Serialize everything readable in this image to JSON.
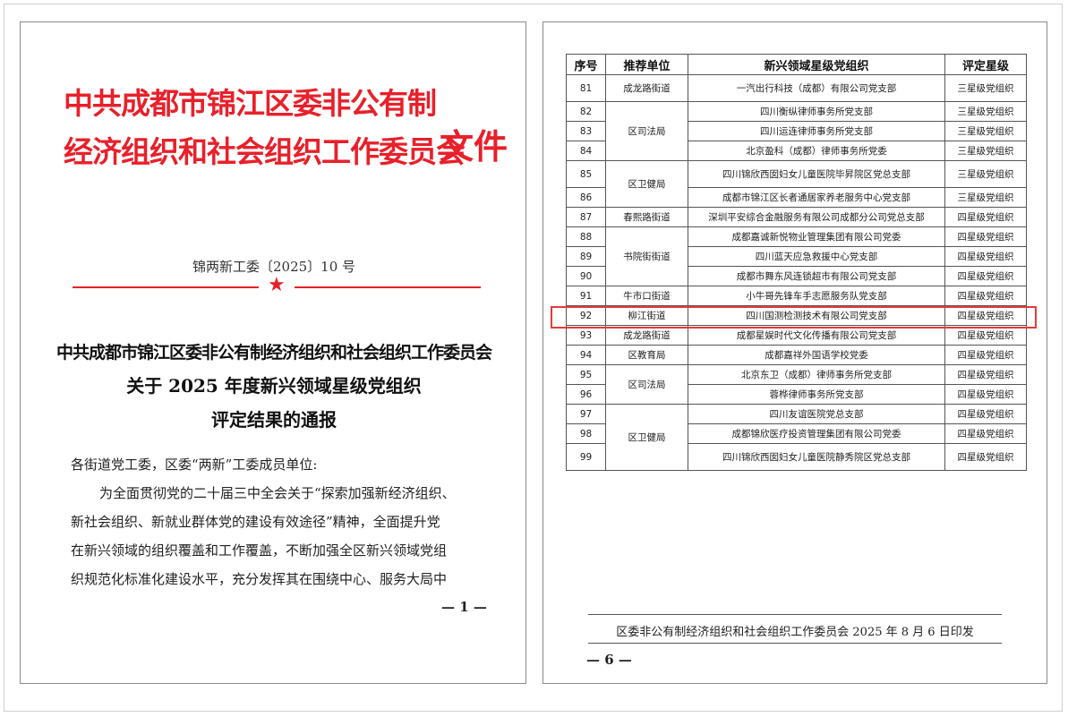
{
  "left_page": {
    "header_lines": [
      "中共成都市锦江区委非公有制",
      "经济组织和社会组织工作委员会"
    ],
    "header_word": "文件",
    "doc_number": "锦两新工委〔2025〕10 号",
    "title_lines": [
      "中共成都市锦江区委非公有制经济组织和社会组织工作委员会",
      "关于 2025 年度新兴领域星级党组织",
      "评定结果的通报"
    ],
    "addressee": "各街道党工委，区委“两新”工委成员单位:",
    "body_lines": [
      "为全面贯彻党的二十届三中全会关于“探索加强新经济组织、",
      "新社会组织、新就业群体党的建设有效途径”精神，全面提升党",
      "在新兴领域的组织覆盖和工作覆盖，不断加强全区新兴领域党组",
      "织规范化标准化建设水平，充分发挥其在围绕中心、服务大局中"
    ],
    "page_number": "— 1 —"
  },
  "right_page": {
    "table": {
      "headers": [
        "序号",
        "推荐单位",
        "新兴领域星级党组织",
        "评定星级"
      ],
      "groups": [
        {
          "unit": "成龙路街道",
          "rows": [
            [
              "81",
              "一汽出行科技（成都）有限公司党支部",
              "三星级党组织"
            ]
          ]
        },
        {
          "unit": "区司法局",
          "rows": [
            [
              "82",
              "四川衡纵律师事务所党支部",
              "三星级党组织"
            ],
            [
              "83",
              "四川运连律师事务所党支部",
              "三星级党组织"
            ],
            [
              "84",
              "北京盈科（成都）律师事务所党委",
              "三星级党组织"
            ]
          ]
        },
        {
          "unit": "区卫健局",
          "rows": [
            [
              "85",
              "四川锦欣西囡妇女儿童医院毕昇院区党总支部",
              "三星级党组织"
            ],
            [
              "86",
              "成都市锦江区长者通居家养老服务中心党支部",
              "三星级党组织"
            ]
          ]
        },
        {
          "unit": "春熙路街道",
          "rows": [
            [
              "87",
              "深圳平安综合金融服务有限公司成都分公司党总支部",
              "四星级党组织"
            ]
          ]
        },
        {
          "unit": "书院街街道",
          "rows": [
            [
              "88",
              "成都嘉诚新悦物业管理集团有限公司党委",
              "四星级党组织"
            ],
            [
              "89",
              "四川蓝天应急救援中心党支部",
              "四星级党组织"
            ],
            [
              "90",
              "成都市舞东风连锁超市有限公司党支部",
              "四星级党组织"
            ]
          ]
        },
        {
          "unit": "牛市口街道",
          "rows": [
            [
              "91",
              "小牛哥先锋车手志愿服务队党支部",
              "四星级党组织"
            ]
          ]
        },
        {
          "unit": "柳江街道",
          "rows": [
            [
              "92",
              "四川国测检测技术有限公司党支部",
              "四星级党组织"
            ]
          ]
        },
        {
          "unit": "成龙路街道",
          "rows": [
            [
              "93",
              "成都星娱时代文化传播有限公司党支部",
              "四星级党组织"
            ]
          ]
        },
        {
          "unit": "区教育局",
          "rows": [
            [
              "94",
              "成都嘉祥外国语学校党委",
              "四星级党组织"
            ]
          ]
        },
        {
          "unit": "区司法局",
          "rows": [
            [
              "95",
              "北京东卫（成都）律师事务所党支部",
              "四星级党组织"
            ],
            [
              "96",
              "蓉桦律师事务所党支部",
              "四星级党组织"
            ]
          ]
        },
        {
          "unit": "区卫健局",
          "rows": [
            [
              "97",
              "四川友谊医院党总支部",
              "四星级党组织"
            ],
            [
              "98",
              "成都锦欣医疗投资管理集团有限公司党委",
              "四星级党组织"
            ],
            [
              "99",
              "四川锦欣西囡妇女儿童医院静秀院区党总支部",
              "四星级党组织"
            ]
          ]
        }
      ],
      "highlighted_row": "92",
      "highlight_color": "#e53b3b"
    },
    "footer": "区委非公有制经济组织和社会组织工作委员会    2025 年 8 月 6 日印发",
    "page_number": "— 6 —"
  },
  "colors": {
    "header_red": "#e8202a",
    "border": "#555555"
  }
}
